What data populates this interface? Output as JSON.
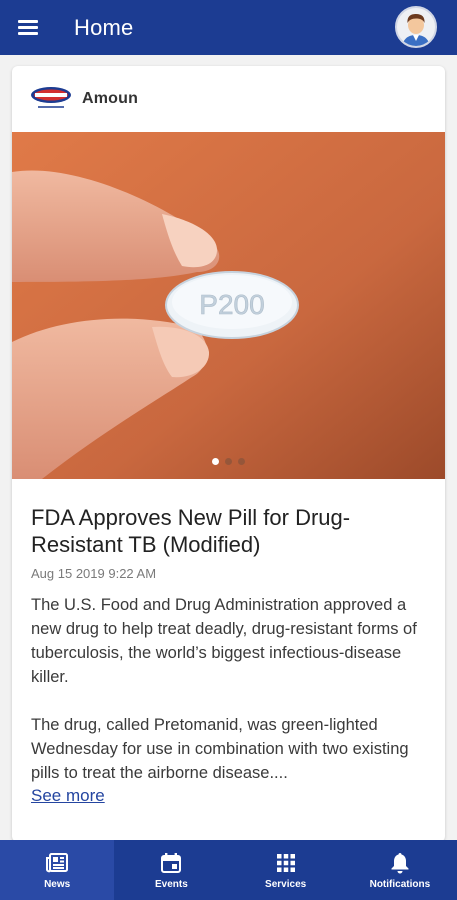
{
  "appbar": {
    "title": "Home"
  },
  "card": {
    "source": "Amoun",
    "logo_text": "amoun",
    "pill_imprint": "P200",
    "carousel": {
      "count": 3,
      "active": 0
    },
    "headline": "FDA Approves New Pill for Drug-Resistant TB (Modified)",
    "date": "Aug 15 2019 9:22 AM",
    "paragraphs": [
      "The U.S. Food and Drug Administration approved a new drug to help treat deadly, drug-resistant forms of tuberculosis, the world’s biggest infectious-disease killer.",
      "The drug, called Pretomanid, was green-lighted Wednesday for use in combination with two existing pills to treat the airborne disease...."
    ],
    "see_more": "See more"
  },
  "bottom_nav": {
    "items": [
      {
        "label": "News",
        "icon": "newspaper-icon",
        "active": true
      },
      {
        "label": "Events",
        "icon": "calendar-icon",
        "active": false
      },
      {
        "label": "Services",
        "icon": "grid-icon",
        "active": false
      },
      {
        "label": "Notifications",
        "icon": "bell-icon",
        "active": false
      }
    ]
  },
  "colors": {
    "primary": "#1c3c92",
    "link": "#2445a0",
    "hero_bg": "#c9683f"
  }
}
